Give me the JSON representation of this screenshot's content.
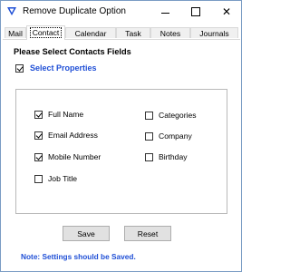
{
  "window": {
    "title": "Remove Duplicate Option",
    "controls": {
      "minimize": "minimize",
      "maximize": "maximize",
      "close": "✕"
    }
  },
  "tabs": [
    {
      "label": "Mail",
      "active": false
    },
    {
      "label": "Contact",
      "active": true
    },
    {
      "label": "Calendar",
      "active": false
    },
    {
      "label": "Task",
      "active": false
    },
    {
      "label": "Notes",
      "active": false
    },
    {
      "label": "Journals",
      "active": false
    }
  ],
  "contact": {
    "section_title": "Please Select Contacts Fields",
    "select_properties": {
      "label": "Select Properties",
      "checked": true
    },
    "fields": [
      {
        "label": "Full Name",
        "checked": true
      },
      {
        "label": "Email Address",
        "checked": true
      },
      {
        "label": "Mobile Number",
        "checked": true
      },
      {
        "label": "Job Title",
        "checked": false
      },
      {
        "label": "Categories",
        "checked": false
      },
      {
        "label": "Company",
        "checked": false
      },
      {
        "label": "Birthday",
        "checked": false
      }
    ],
    "buttons": {
      "save": "Save",
      "reset": "Reset"
    },
    "note": "Note: Settings should be Saved."
  },
  "colors": {
    "accent_blue": "#1f4fd6",
    "border": "#b9b9b9",
    "button_bg": "#e1e1e1"
  }
}
